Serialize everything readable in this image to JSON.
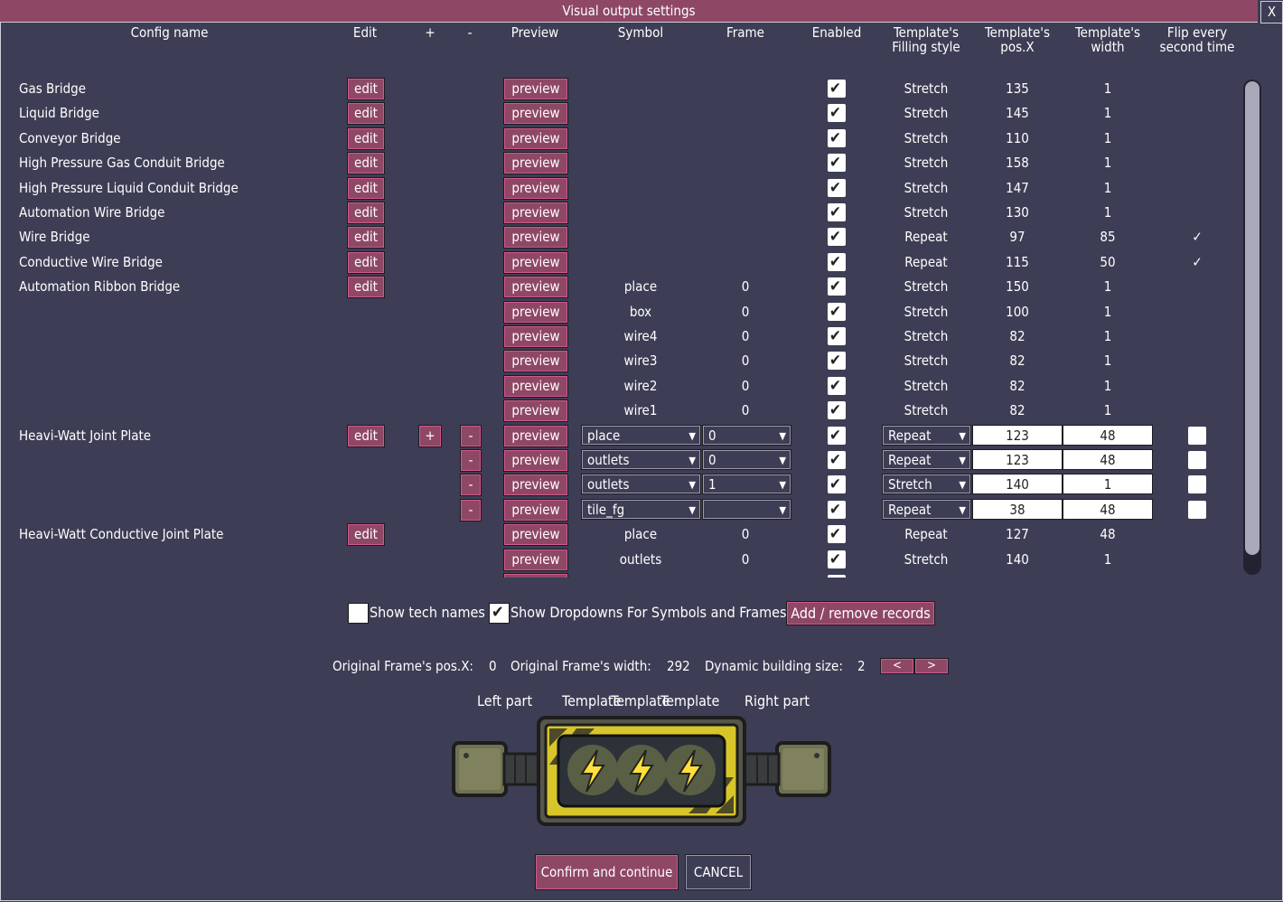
{
  "window": {
    "title": "Visual output settings",
    "close": "X"
  },
  "headers": {
    "config_name": "Config name",
    "edit": "Edit",
    "plus": "+",
    "minus": "-",
    "preview": "Preview",
    "symbol": "Symbol",
    "frame": "Frame",
    "enabled": "Enabled",
    "filling_style": "Template's\nFilling style",
    "pos_x": "Template's\npos.X",
    "width": "Template's\nwidth",
    "flip": "Flip every\nsecond time"
  },
  "labels": {
    "edit": "edit",
    "preview": "preview",
    "plus": "+",
    "minus": "-",
    "dd_arrow": "▼"
  },
  "rows": [
    {
      "name": "Gas Bridge",
      "edit": true,
      "symbol": "",
      "frame": "",
      "enabled": true,
      "style": "Stretch",
      "pos_x": "135",
      "width": "1",
      "flip": ""
    },
    {
      "name": "Liquid Bridge",
      "edit": true,
      "symbol": "",
      "frame": "",
      "enabled": true,
      "style": "Stretch",
      "pos_x": "145",
      "width": "1",
      "flip": ""
    },
    {
      "name": "Conveyor Bridge",
      "edit": true,
      "symbol": "",
      "frame": "",
      "enabled": true,
      "style": "Stretch",
      "pos_x": "110",
      "width": "1",
      "flip": ""
    },
    {
      "name": "High Pressure Gas Conduit Bridge",
      "edit": true,
      "symbol": "",
      "frame": "",
      "enabled": true,
      "style": "Stretch",
      "pos_x": "158",
      "width": "1",
      "flip": ""
    },
    {
      "name": "High Pressure Liquid Conduit Bridge",
      "edit": true,
      "symbol": "",
      "frame": "",
      "enabled": true,
      "style": "Stretch",
      "pos_x": "147",
      "width": "1",
      "flip": ""
    },
    {
      "name": "Automation Wire Bridge",
      "edit": true,
      "symbol": "",
      "frame": "",
      "enabled": true,
      "style": "Stretch",
      "pos_x": "130",
      "width": "1",
      "flip": ""
    },
    {
      "name": "Wire Bridge",
      "edit": true,
      "symbol": "",
      "frame": "",
      "enabled": true,
      "style": "Repeat",
      "pos_x": "97",
      "width": "85",
      "flip": "✓"
    },
    {
      "name": "Conductive Wire Bridge",
      "edit": true,
      "symbol": "",
      "frame": "",
      "enabled": true,
      "style": "Repeat",
      "pos_x": "115",
      "width": "50",
      "flip": "✓"
    },
    {
      "name": "Automation Ribbon Bridge",
      "edit": true,
      "symbol": "place",
      "frame": "0",
      "enabled": true,
      "style": "Stretch",
      "pos_x": "150",
      "width": "1",
      "flip": ""
    },
    {
      "name": "",
      "edit": false,
      "symbol": "box",
      "frame": "0",
      "enabled": true,
      "style": "Stretch",
      "pos_x": "100",
      "width": "1",
      "flip": ""
    },
    {
      "name": "",
      "edit": false,
      "symbol": "wire4",
      "frame": "0",
      "enabled": true,
      "style": "Stretch",
      "pos_x": "82",
      "width": "1",
      "flip": ""
    },
    {
      "name": "",
      "edit": false,
      "symbol": "wire3",
      "frame": "0",
      "enabled": true,
      "style": "Stretch",
      "pos_x": "82",
      "width": "1",
      "flip": ""
    },
    {
      "name": "",
      "edit": false,
      "symbol": "wire2",
      "frame": "0",
      "enabled": true,
      "style": "Stretch",
      "pos_x": "82",
      "width": "1",
      "flip": ""
    },
    {
      "name": "",
      "edit": false,
      "symbol": "wire1",
      "frame": "0",
      "enabled": true,
      "style": "Stretch",
      "pos_x": "82",
      "width": "1",
      "flip": ""
    },
    {
      "name": "Heavi-Watt Joint Plate",
      "edit": true,
      "editable": true,
      "plus": true,
      "symbol": "place",
      "frame": "0",
      "enabled": true,
      "style": "Repeat",
      "pos_x": "123",
      "width": "48",
      "flip_box": false
    },
    {
      "name": "",
      "edit": false,
      "editable": true,
      "symbol": "outlets",
      "frame": "0",
      "enabled": true,
      "style": "Repeat",
      "pos_x": "123",
      "width": "48",
      "flip_box": false
    },
    {
      "name": "",
      "edit": false,
      "editable": true,
      "symbol": "outlets",
      "frame": "1",
      "enabled": true,
      "style": "Stretch",
      "pos_x": "140",
      "width": "1",
      "flip_box": false
    },
    {
      "name": "",
      "edit": false,
      "editable": true,
      "symbol": "tile_fg",
      "frame": "",
      "enabled": true,
      "style": "Repeat",
      "pos_x": "38",
      "width": "48",
      "flip_box": false
    },
    {
      "name": "Heavi-Watt Conductive Joint Plate",
      "edit": true,
      "symbol": "place",
      "frame": "0",
      "enabled": true,
      "style": "Repeat",
      "pos_x": "127",
      "width": "48",
      "flip": ""
    },
    {
      "name": "",
      "edit": false,
      "symbol": "outlets",
      "frame": "0",
      "enabled": true,
      "style": "Stretch",
      "pos_x": "140",
      "width": "1",
      "flip": ""
    },
    {
      "name": "",
      "edit": false,
      "symbol": "",
      "frame": "",
      "enabled": true,
      "style": "",
      "pos_x": "",
      "width": "",
      "flip": ""
    }
  ],
  "options": {
    "show_tech_names": {
      "label": "Show tech names",
      "checked": false
    },
    "show_dropdowns": {
      "label": "Show Dropdowns For Symbols and Frames",
      "checked": true
    },
    "add_remove": "Add / remove records"
  },
  "info": {
    "orig_pos_label": "Original Frame's pos.X:",
    "orig_pos_value": "0",
    "orig_width_label": "Original Frame's width:",
    "orig_width_value": "292",
    "dyn_size_label": "Dynamic building size:",
    "dyn_size_value": "2",
    "prev": "<",
    "next": ">"
  },
  "parts": {
    "left": "Left part",
    "template1": "Template",
    "template2": "Template",
    "template3": "Template",
    "right": "Right part"
  },
  "footer": {
    "confirm": "Confirm and continue",
    "cancel": "CANCEL"
  },
  "colors": {
    "background": "#3d3e55",
    "accent": "#8f4766",
    "hazard_yellow": "#d8c52a"
  }
}
